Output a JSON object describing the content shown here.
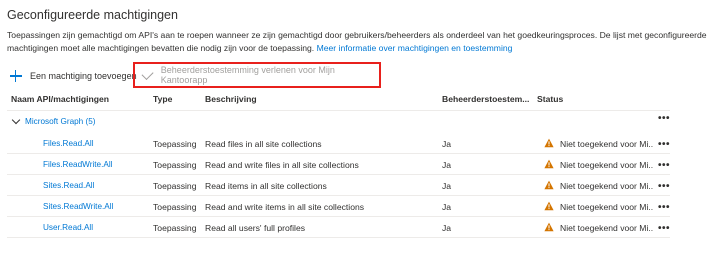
{
  "page": {
    "title": "Geconfigureerde machtigingen",
    "description": "Toepassingen zijn gemachtigd om API's aan te roepen wanneer ze zijn gemachtigd door gebruikers/beheerders als onderdeel van het goedkeuringsproces. De lijst met geconfigureerde machtigingen moet alle machtigingen bevatten die nodig zijn voor de toepassing. ",
    "description_link": "Meer informatie over machtigingen en toestemming"
  },
  "toolbar": {
    "add_label": "Een machtiging toevoegen",
    "grant_label": "Beheerderstoestemming verlenen voor Mijn Kantoorapp"
  },
  "colors": {
    "accent": "#0078d4",
    "highlight_border": "#e8201c",
    "warning": "#d47500"
  },
  "table": {
    "headers": {
      "name": "Naam API/machtigingen",
      "type": "Type",
      "description": "Beschrijving",
      "admin_consent": "Beheerderstoestem...",
      "status": "Status"
    },
    "group": {
      "label": "Microsoft Graph (5)",
      "more": "•••"
    },
    "rows": [
      {
        "name": "Files.Read.All",
        "type": "Toepassing",
        "description": "Read files in all site collections",
        "admin_consent": "Ja",
        "status": "Niet toegekend voor Mi...",
        "more": "•••"
      },
      {
        "name": "Files.ReadWrite.All",
        "type": "Toepassing",
        "description": "Read and write files in all site collections",
        "admin_consent": "Ja",
        "status": "Niet toegekend voor Mi...",
        "more": "•••"
      },
      {
        "name": "Sites.Read.All",
        "type": "Toepassing",
        "description": "Read items in all site collections",
        "admin_consent": "Ja",
        "status": "Niet toegekend voor Mi...",
        "more": "•••"
      },
      {
        "name": "Sites.ReadWrite.All",
        "type": "Toepassing",
        "description": "Read and write items in all site collections",
        "admin_consent": "Ja",
        "status": "Niet toegekend voor Mi...",
        "more": "•••"
      },
      {
        "name": "User.Read.All",
        "type": "Toepassing",
        "description": "Read all users' full profiles",
        "admin_consent": "Ja",
        "status": "Niet toegekend voor Mi...",
        "more": "•••"
      }
    ]
  }
}
